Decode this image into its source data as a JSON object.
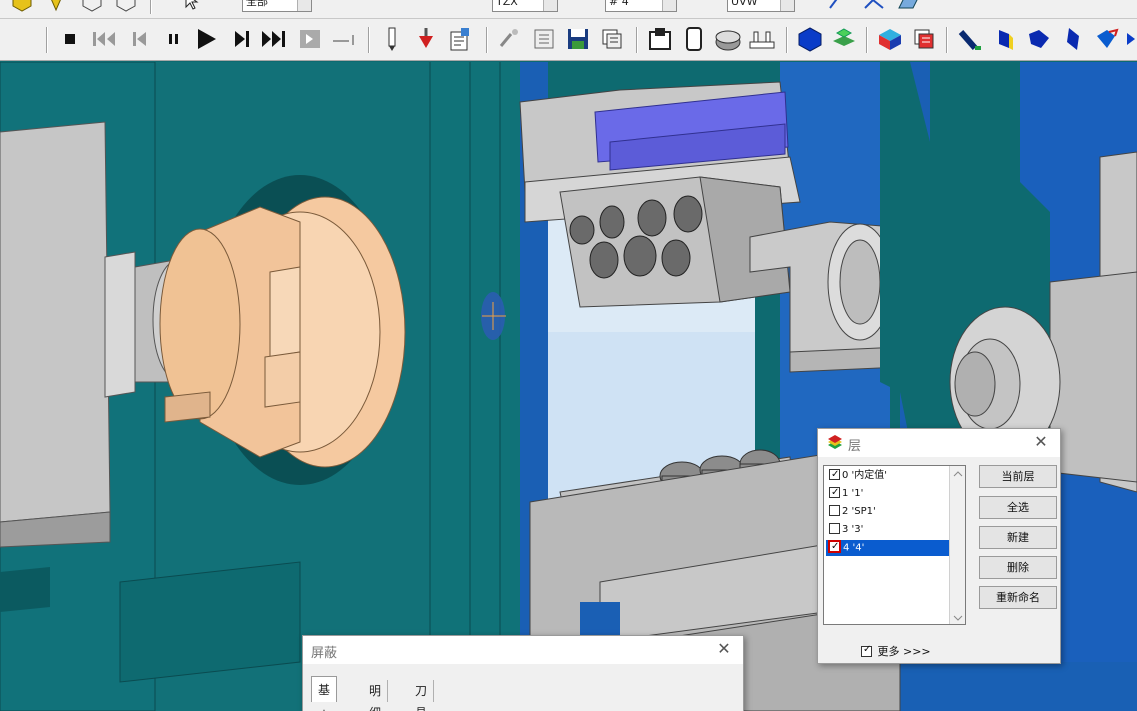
{
  "toolbar_top": {
    "combo_all": "全部",
    "combo_mode": "TZX",
    "combo_layer": "# 4",
    "combo_view": "UVW"
  },
  "toolbar_bottom": {
    "icons": [
      "stop-icon",
      "rewind-icon",
      "step-back-icon",
      "pause-icon",
      "play-icon",
      "step-forward-icon",
      "fast-forward-icon",
      "end-icon",
      "reset-icon",
      "pencil-icon",
      "tool-red-icon",
      "report-icon",
      "search-icon",
      "list-icon",
      "save-icon",
      "stack-icon",
      "machine-icon",
      "blank-icon",
      "cylinder-icon",
      "fixture-icon",
      "cube-icon",
      "stock-icon",
      "color-cube-icon",
      "stack2-icon",
      "tool-green-icon",
      "tool-yellow-icon",
      "tool-blue-icon",
      "tool-blue2-icon",
      "rotate-icon"
    ]
  },
  "layer_dialog": {
    "title": "层",
    "layers": [
      {
        "label": "0 '内定值'",
        "checked": true,
        "selected": false
      },
      {
        "label": "1 '1'",
        "checked": true,
        "selected": false
      },
      {
        "label": "2 'SP1'",
        "checked": false,
        "selected": false
      },
      {
        "label": "3 '3'",
        "checked": false,
        "selected": false
      },
      {
        "label": "4 '4'",
        "checked": true,
        "selected": true
      }
    ],
    "buttons": {
      "current": "当前层",
      "select_all": "全选",
      "new": "新建",
      "delete": "删除",
      "rename": "重新命名"
    },
    "more_label": "更多 >>>",
    "more_checked": true
  },
  "mask_dialog": {
    "title": "屏蔽",
    "tabs": [
      "基本",
      "明细",
      "刀具路径"
    ]
  },
  "colors": {
    "teal": "#0e6a70",
    "machine_grey": "#c8c8c8",
    "chuck_peach": "#f5c9a0",
    "blue_part": "#1a5fb4",
    "purple_slide": "#6a6ae8",
    "selection": "#0a5ccf"
  }
}
